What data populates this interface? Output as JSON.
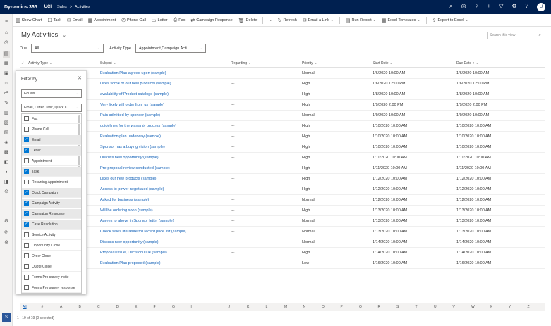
{
  "topnav": {
    "brand": "Dynamics 365",
    "org": "UCI",
    "crumb_app": "Sales",
    "crumb_sep": ">",
    "crumb_page": "Activities",
    "icons": [
      "search-icon",
      "target-icon",
      "lightbulb-icon",
      "plus-icon",
      "filter-icon",
      "gear-icon",
      "help-icon"
    ],
    "avatar_initials": "U"
  },
  "cmdbar": {
    "show_chart": "Show Chart",
    "task": "Task",
    "email": "Email",
    "appointment": "Appointment",
    "phone_call": "Phone Call",
    "letter": "Letter",
    "fax": "Fax",
    "campaign_response": "Campaign Response",
    "delete": "Delete",
    "refresh": "Refresh",
    "email_link": "Email a Link",
    "run_report": "Run Report",
    "excel_templates": "Excel Templates",
    "export_excel": "Export to Excel"
  },
  "view": {
    "title": "My Activities",
    "search_placeholder": "Search this view"
  },
  "filters": {
    "due_label": "Due",
    "due_value": "All",
    "type_label": "Activity Type",
    "type_value": "Appointment,Campaign Acti..."
  },
  "columns": {
    "activity_type": "Activity Type",
    "subject": "Subject",
    "regarding": "Regarding",
    "priority": "Priority",
    "start_date": "Start Date",
    "due_date": "Due Date",
    "sort_arrow": "↑"
  },
  "rows": [
    {
      "subject": "Evaluation Plan agreed upon (sample)",
      "regarding": "---",
      "priority": "Normal",
      "start": "1/6/2020 10:00 AM",
      "due": "1/6/2020 10:00 AM"
    },
    {
      "subject": "Likes some of our new products (sample)",
      "regarding": "---",
      "priority": "High",
      "start": "1/6/2020 12:00 PM",
      "due": "1/6/2020 12:00 PM"
    },
    {
      "subject": "availability of Product catalogs (sample)",
      "regarding": "---",
      "priority": "High",
      "start": "1/8/2020 10:00 AM",
      "due": "1/8/2020 10:00 AM"
    },
    {
      "subject": "Very likely will order from us (sample)",
      "regarding": "---",
      "priority": "High",
      "start": "1/9/2020 2:00 PM",
      "due": "1/9/2020 2:00 PM"
    },
    {
      "subject": "Pain admitted by sponsor (sample)",
      "regarding": "---",
      "priority": "Normal",
      "start": "1/9/2020 10:00 AM",
      "due": "1/9/2020 10:00 AM"
    },
    {
      "subject": "guidelines for the warranty process (sample)",
      "regarding": "---",
      "priority": "High",
      "start": "1/10/2020 10:00 AM",
      "due": "1/10/2020 10:00 AM"
    },
    {
      "subject": "Evaluation plan underway (sample)",
      "regarding": "---",
      "priority": "High",
      "start": "1/10/2020 10:00 AM",
      "due": "1/10/2020 10:00 AM"
    },
    {
      "subject": "Sponsor has a buying vision (sample)",
      "regarding": "---",
      "priority": "High",
      "start": "1/10/2020 10:00 AM",
      "due": "1/10/2020 10:00 AM"
    },
    {
      "subject": "Discuss new opportunity (sample)",
      "regarding": "---",
      "priority": "High",
      "start": "1/11/2020 10:00 AM",
      "due": "1/11/2020 10:00 AM"
    },
    {
      "subject": "Pre-proposal review conducted (sample)",
      "regarding": "---",
      "priority": "High",
      "start": "1/11/2020 10:00 AM",
      "due": "1/11/2020 10:00 AM"
    },
    {
      "subject": "Likes our new products (sample)",
      "regarding": "---",
      "priority": "High",
      "start": "1/12/2020 10:00 AM",
      "due": "1/12/2020 10:00 AM"
    },
    {
      "subject": "Access to power negotiated (sample)",
      "regarding": "---",
      "priority": "High",
      "start": "1/12/2020 10:00 AM",
      "due": "1/12/2020 10:00 AM"
    },
    {
      "subject": "Asked for business (sample)",
      "regarding": "---",
      "priority": "Normal",
      "start": "1/12/2020 10:00 AM",
      "due": "1/12/2020 10:00 AM"
    },
    {
      "subject": "Will be ordering soon (sample)",
      "regarding": "---",
      "priority": "High",
      "start": "1/13/2020 10:00 AM",
      "due": "1/13/2020 10:00 AM"
    },
    {
      "subject": "Agrees to above in Sponsor letter (sample)",
      "regarding": "---",
      "priority": "Normal",
      "start": "1/13/2020 10:00 AM",
      "due": "1/13/2020 10:00 AM"
    },
    {
      "subject": "Check sales literature for recent price list (sample)",
      "regarding": "---",
      "priority": "Normal",
      "start": "1/13/2020 10:00 AM",
      "due": "1/13/2020 10:00 AM"
    },
    {
      "subject": "Discuss new opportunity (sample)",
      "regarding": "---",
      "priority": "Normal",
      "start": "1/14/2020 10:00 AM",
      "due": "1/14/2020 10:00 AM"
    },
    {
      "subject": "Proposal issue, Decision Due (sample)",
      "regarding": "---",
      "priority": "High",
      "start": "1/14/2020 10:00 AM",
      "due": "1/14/2020 10:00 AM"
    },
    {
      "subject": "Evaluation Plan proposed (sample)",
      "regarding": "---",
      "priority": "Low",
      "start": "1/16/2020 10:00 AM",
      "due": "1/16/2020 10:00 AM"
    }
  ],
  "filter_panel": {
    "title": "Filter by",
    "operator": "Equals",
    "value": "Email, Letter, Task, Quick C...",
    "items": [
      {
        "label": "Fax",
        "checked": false
      },
      {
        "label": "Phone Call",
        "checked": false
      },
      {
        "label": "Email",
        "checked": true
      },
      {
        "label": "Letter",
        "checked": true
      },
      {
        "label": "Appointment",
        "checked": false
      },
      {
        "label": "Task",
        "checked": true
      },
      {
        "label": "Recurring Appointment",
        "checked": false
      },
      {
        "label": "Quick Campaign",
        "checked": true
      },
      {
        "label": "Campaign Activity",
        "checked": true
      },
      {
        "label": "Campaign Response",
        "checked": true
      },
      {
        "label": "Case Resolution",
        "checked": true
      },
      {
        "label": "Service Activity",
        "checked": false
      },
      {
        "label": "Opportunity Close",
        "checked": false
      },
      {
        "label": "Order Close",
        "checked": false
      },
      {
        "label": "Quote Close",
        "checked": false
      },
      {
        "label": "Forms Pro survey invite",
        "checked": false
      },
      {
        "label": "Forms Pro survey response",
        "checked": false
      }
    ]
  },
  "alpha": [
    "All",
    "#",
    "A",
    "B",
    "C",
    "D",
    "E",
    "F",
    "G",
    "H",
    "I",
    "J",
    "K",
    "L",
    "M",
    "N",
    "O",
    "P",
    "Q",
    "R",
    "S",
    "T",
    "U",
    "V",
    "W",
    "X",
    "Y",
    "Z"
  ],
  "footer": "1 - 19 of 19 (0 selected)",
  "rail_badge": "S"
}
